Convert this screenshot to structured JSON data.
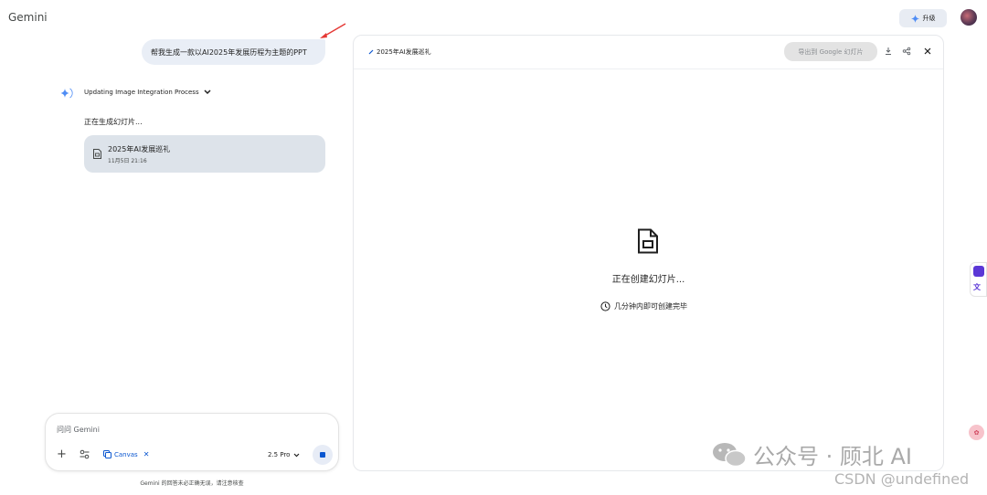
{
  "app": {
    "title": "Gemini"
  },
  "topbar": {
    "upgrade_label": "升级"
  },
  "chat": {
    "user_message": "帮我生成一款以AI2025年发展历程为主题的PPT",
    "thinking_title": "Updating Image Integration Process",
    "status": "正在生成幻灯片...",
    "file_card": {
      "name": "2025年AI发展巡礼",
      "date": "11月5日 21:16"
    }
  },
  "composer": {
    "placeholder": "问问 Gemini",
    "canvas_label": "Canvas",
    "model_label": "2.5 Pro",
    "disclaimer": "Gemini 的回答未必正确无误，请注意核查"
  },
  "canvas": {
    "title": "2025年AI发展巡礼",
    "export_label": "导出到 Google 幻灯片",
    "creating_text": "正在创建幻灯片...",
    "eta_text": "几分钟内即可创建完毕"
  },
  "watermark": {
    "account": "公众号 · 顾北 AI",
    "csdn": "CSDN @undefined"
  },
  "colors": {
    "accent": "#0b57d0",
    "bubble": "#e9eef6",
    "card": "#dde3ea",
    "annotation_arrow": "#e53935"
  }
}
